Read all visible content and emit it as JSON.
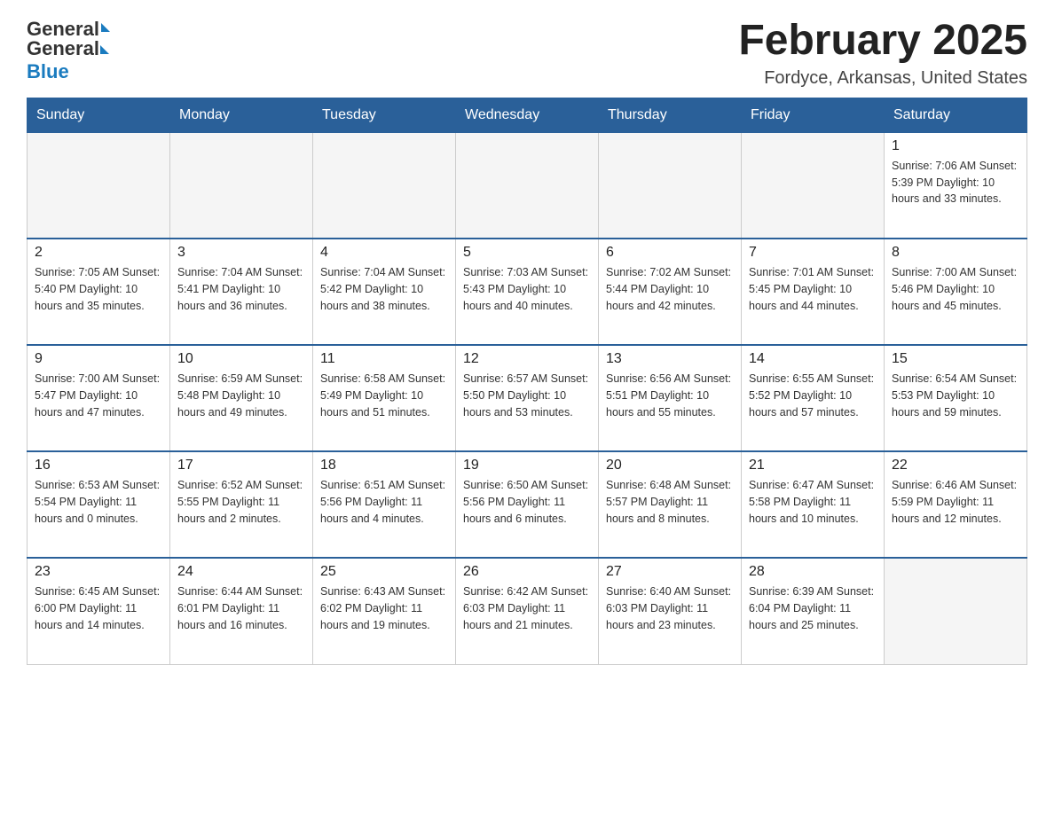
{
  "header": {
    "logo_general": "General",
    "logo_blue": "Blue",
    "month_title": "February 2025",
    "location": "Fordyce, Arkansas, United States"
  },
  "weekdays": [
    "Sunday",
    "Monday",
    "Tuesday",
    "Wednesday",
    "Thursday",
    "Friday",
    "Saturday"
  ],
  "weeks": [
    [
      {
        "day": "",
        "info": ""
      },
      {
        "day": "",
        "info": ""
      },
      {
        "day": "",
        "info": ""
      },
      {
        "day": "",
        "info": ""
      },
      {
        "day": "",
        "info": ""
      },
      {
        "day": "",
        "info": ""
      },
      {
        "day": "1",
        "info": "Sunrise: 7:06 AM\nSunset: 5:39 PM\nDaylight: 10 hours\nand 33 minutes."
      }
    ],
    [
      {
        "day": "2",
        "info": "Sunrise: 7:05 AM\nSunset: 5:40 PM\nDaylight: 10 hours\nand 35 minutes."
      },
      {
        "day": "3",
        "info": "Sunrise: 7:04 AM\nSunset: 5:41 PM\nDaylight: 10 hours\nand 36 minutes."
      },
      {
        "day": "4",
        "info": "Sunrise: 7:04 AM\nSunset: 5:42 PM\nDaylight: 10 hours\nand 38 minutes."
      },
      {
        "day": "5",
        "info": "Sunrise: 7:03 AM\nSunset: 5:43 PM\nDaylight: 10 hours\nand 40 minutes."
      },
      {
        "day": "6",
        "info": "Sunrise: 7:02 AM\nSunset: 5:44 PM\nDaylight: 10 hours\nand 42 minutes."
      },
      {
        "day": "7",
        "info": "Sunrise: 7:01 AM\nSunset: 5:45 PM\nDaylight: 10 hours\nand 44 minutes."
      },
      {
        "day": "8",
        "info": "Sunrise: 7:00 AM\nSunset: 5:46 PM\nDaylight: 10 hours\nand 45 minutes."
      }
    ],
    [
      {
        "day": "9",
        "info": "Sunrise: 7:00 AM\nSunset: 5:47 PM\nDaylight: 10 hours\nand 47 minutes."
      },
      {
        "day": "10",
        "info": "Sunrise: 6:59 AM\nSunset: 5:48 PM\nDaylight: 10 hours\nand 49 minutes."
      },
      {
        "day": "11",
        "info": "Sunrise: 6:58 AM\nSunset: 5:49 PM\nDaylight: 10 hours\nand 51 minutes."
      },
      {
        "day": "12",
        "info": "Sunrise: 6:57 AM\nSunset: 5:50 PM\nDaylight: 10 hours\nand 53 minutes."
      },
      {
        "day": "13",
        "info": "Sunrise: 6:56 AM\nSunset: 5:51 PM\nDaylight: 10 hours\nand 55 minutes."
      },
      {
        "day": "14",
        "info": "Sunrise: 6:55 AM\nSunset: 5:52 PM\nDaylight: 10 hours\nand 57 minutes."
      },
      {
        "day": "15",
        "info": "Sunrise: 6:54 AM\nSunset: 5:53 PM\nDaylight: 10 hours\nand 59 minutes."
      }
    ],
    [
      {
        "day": "16",
        "info": "Sunrise: 6:53 AM\nSunset: 5:54 PM\nDaylight: 11 hours\nand 0 minutes."
      },
      {
        "day": "17",
        "info": "Sunrise: 6:52 AM\nSunset: 5:55 PM\nDaylight: 11 hours\nand 2 minutes."
      },
      {
        "day": "18",
        "info": "Sunrise: 6:51 AM\nSunset: 5:56 PM\nDaylight: 11 hours\nand 4 minutes."
      },
      {
        "day": "19",
        "info": "Sunrise: 6:50 AM\nSunset: 5:56 PM\nDaylight: 11 hours\nand 6 minutes."
      },
      {
        "day": "20",
        "info": "Sunrise: 6:48 AM\nSunset: 5:57 PM\nDaylight: 11 hours\nand 8 minutes."
      },
      {
        "day": "21",
        "info": "Sunrise: 6:47 AM\nSunset: 5:58 PM\nDaylight: 11 hours\nand 10 minutes."
      },
      {
        "day": "22",
        "info": "Sunrise: 6:46 AM\nSunset: 5:59 PM\nDaylight: 11 hours\nand 12 minutes."
      }
    ],
    [
      {
        "day": "23",
        "info": "Sunrise: 6:45 AM\nSunset: 6:00 PM\nDaylight: 11 hours\nand 14 minutes."
      },
      {
        "day": "24",
        "info": "Sunrise: 6:44 AM\nSunset: 6:01 PM\nDaylight: 11 hours\nand 16 minutes."
      },
      {
        "day": "25",
        "info": "Sunrise: 6:43 AM\nSunset: 6:02 PM\nDaylight: 11 hours\nand 19 minutes."
      },
      {
        "day": "26",
        "info": "Sunrise: 6:42 AM\nSunset: 6:03 PM\nDaylight: 11 hours\nand 21 minutes."
      },
      {
        "day": "27",
        "info": "Sunrise: 6:40 AM\nSunset: 6:03 PM\nDaylight: 11 hours\nand 23 minutes."
      },
      {
        "day": "28",
        "info": "Sunrise: 6:39 AM\nSunset: 6:04 PM\nDaylight: 11 hours\nand 25 minutes."
      },
      {
        "day": "",
        "info": ""
      }
    ]
  ]
}
